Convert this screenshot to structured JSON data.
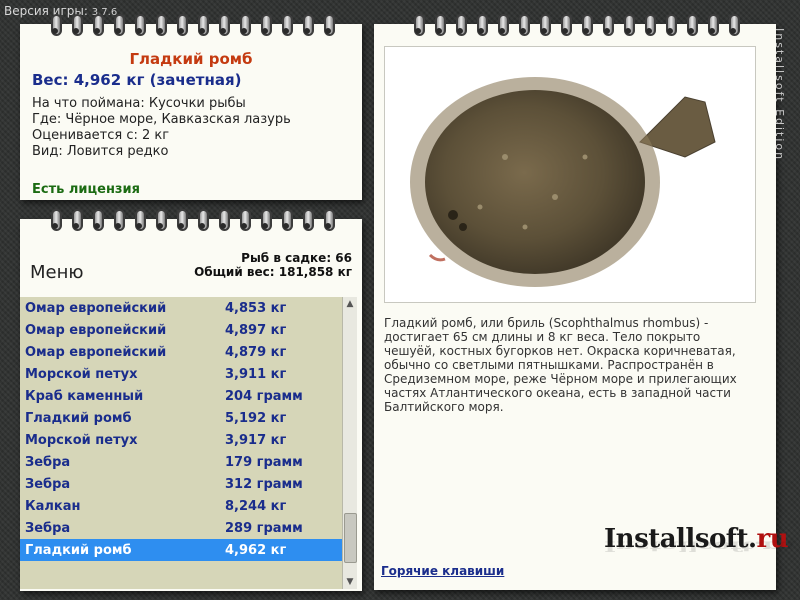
{
  "version": {
    "label": "Версия игры:",
    "number": "3.7.6"
  },
  "info": {
    "title": "Гладкий ромб",
    "weight": "Вес: 4,962 кг (зачетная)",
    "caught_with": "На что поймана: Кусочки рыбы",
    "location": "Где: Чёрное море, Кавказская лазурь",
    "valued_from": "Оценивается с: 2 кг",
    "kind": "Вид: Ловится редко",
    "license": "Есть лицензия"
  },
  "panel": {
    "menu_label": "Меню",
    "fish_in_keepnet": "Рыб в садке: 66",
    "total_weight": "Общий вес: 181,858 кг"
  },
  "fish_list": [
    {
      "name": "Омар европейский",
      "weight": "4,853 кг"
    },
    {
      "name": "Омар европейский",
      "weight": "4,897 кг"
    },
    {
      "name": "Омар европейский",
      "weight": "4,879 кг"
    },
    {
      "name": "Морской петух",
      "weight": "3,911 кг"
    },
    {
      "name": "Краб каменный",
      "weight": "204 грамм"
    },
    {
      "name": "Гладкий ромб",
      "weight": "5,192 кг"
    },
    {
      "name": "Морской петух",
      "weight": "3,917 кг"
    },
    {
      "name": "Зебра",
      "weight": "179 грамм"
    },
    {
      "name": "Зебра",
      "weight": "312 грамм"
    },
    {
      "name": "Калкан",
      "weight": "8,244 кг"
    },
    {
      "name": "Зебра",
      "weight": "289 грамм"
    },
    {
      "name": "Гладкий ромб",
      "weight": "4,962 кг"
    }
  ],
  "selected_index": 11,
  "description": "Гладкий ромб, или бриль (Scophthalmus rhombus) - достигает 65 см длины и 8 кг веса. Тело покрыто чешуёй, костных бугорков нет. Окраска коричневатая, обычно со светлыми пятнышками. Распространён в Средиземном море, реже Чёрном море и прилегающих частях Атлантического океана, есть в западной части Балтийского моря.",
  "hotkeys_link": "Горячие клавиши",
  "brand": {
    "main": "Installsoft.",
    "ru": "ru"
  },
  "vertical_watermark": "Installsoft Edition",
  "icons": [
    "notebook-ring-icon",
    "scroll-up-arrow-icon",
    "scroll-down-arrow-icon",
    "fish-photo"
  ],
  "colors": {
    "title": "#c43a10",
    "text_blue": "#1a2d8c",
    "license": "#1b6b12",
    "selected": "#2e8ef0",
    "list_bg": "#d6d6b8"
  }
}
